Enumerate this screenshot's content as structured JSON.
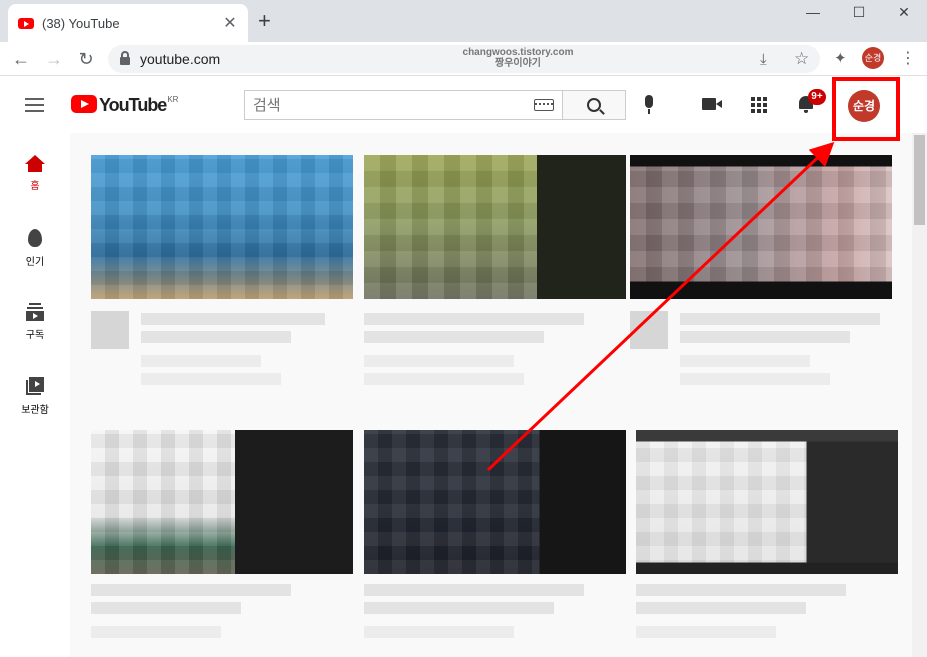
{
  "browser": {
    "tab_title": "(38) YouTube",
    "tab_close": "✕",
    "new_tab": "+",
    "window_controls": {
      "minimize": "—",
      "maximize": "☐",
      "close": "✕"
    },
    "nav": {
      "back": "←",
      "forward": "→",
      "reload": "↻"
    },
    "url": "youtube.com",
    "watermark_line1": "changwoos.tistory.com",
    "watermark_line2": "짱우이야기",
    "omnibox_icons": {
      "install": "⤓",
      "bookmark": "☆"
    },
    "extensions_icon": "✦",
    "profile_label": "순경",
    "menu": "⋮"
  },
  "youtube": {
    "logo_text": "YouTube",
    "region": "KR",
    "search_placeholder": "검색",
    "notification_badge": "9+",
    "avatar_label": "순경",
    "sidebar": [
      {
        "label": "홈",
        "icon": "home-icon",
        "active": true
      },
      {
        "label": "인기",
        "icon": "fire-icon",
        "active": false
      },
      {
        "label": "구독",
        "icon": "subscriptions-icon",
        "active": false
      },
      {
        "label": "보관함",
        "icon": "library-icon",
        "active": false
      }
    ]
  },
  "colors": {
    "brand_red": "#ff0000",
    "active_red": "#cc0000",
    "avatar": "#c0392b",
    "annotation": "#ff0000"
  }
}
